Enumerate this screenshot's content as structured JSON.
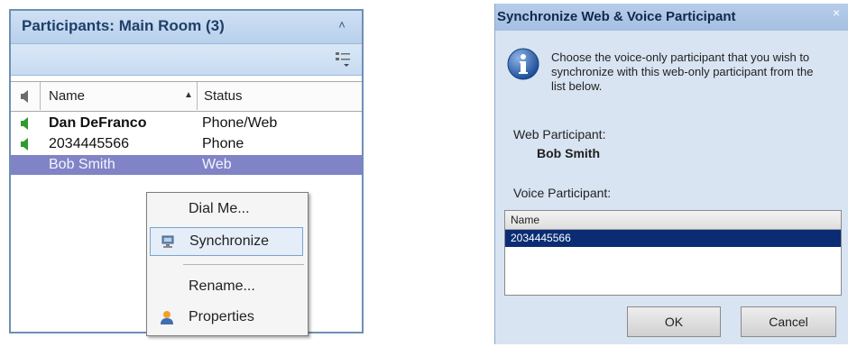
{
  "participants_panel": {
    "title": "Participants: Main Room (3)",
    "columns": {
      "name": "Name",
      "status": "Status"
    },
    "rows": [
      {
        "name": "Dan DeFranco",
        "status": "Phone/Web",
        "bold": true,
        "speaker": true,
        "selected": false
      },
      {
        "name": "2034445566",
        "status": "Phone",
        "bold": false,
        "speaker": true,
        "selected": false
      },
      {
        "name": "Bob Smith",
        "status": "Web",
        "bold": false,
        "speaker": false,
        "selected": true
      }
    ],
    "context_menu": {
      "items": [
        {
          "label": "Dial Me...",
          "icon": null
        },
        {
          "label": "Synchronize",
          "icon": "sync-icon",
          "hover": true
        },
        {
          "label": "Rename...",
          "icon": null
        },
        {
          "label": "Properties",
          "icon": "person-icon"
        }
      ]
    }
  },
  "sync_dialog": {
    "title": "Synchronize Web & Voice Participant",
    "close_glyph": "×",
    "instructions": "Choose the voice-only participant that you wish to synchronize with this web-only participant from the list below.",
    "web_participant_label": "Web Participant:",
    "web_participant_value": "Bob Smith",
    "voice_participant_label": "Voice Participant:",
    "list_header": "Name",
    "list_items": [
      "2034445566"
    ],
    "ok_label": "OK",
    "cancel_label": "Cancel"
  },
  "colors": {
    "selection": "#8084c6",
    "dialog_bg": "#d8e4f2",
    "list_selection": "#0b2c74",
    "speaker_green": "#2e9b2e"
  }
}
